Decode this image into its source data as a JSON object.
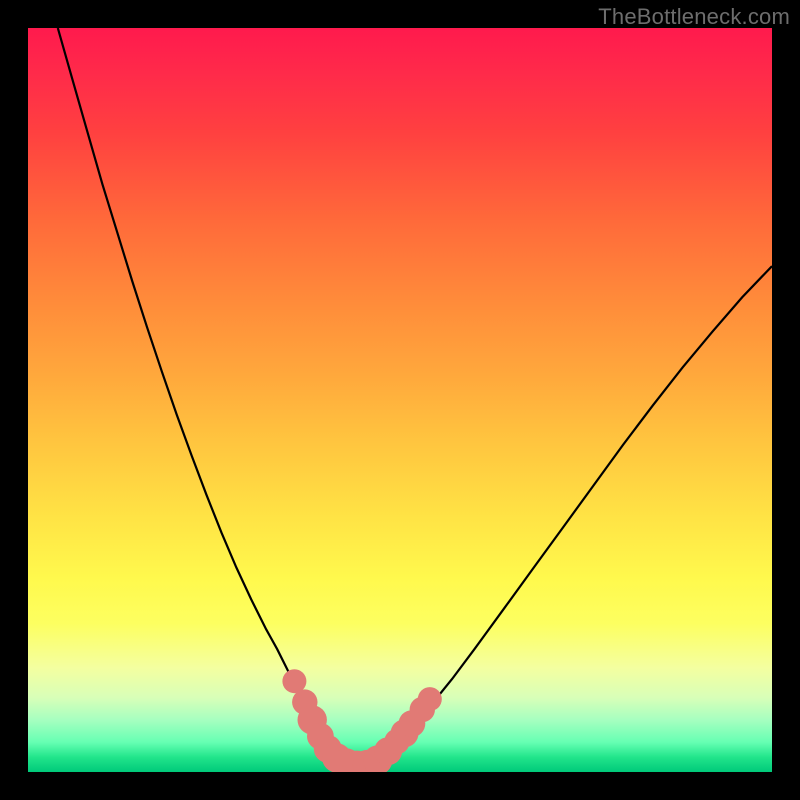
{
  "watermark": "TheBottleneck.com",
  "colors": {
    "frame": "#000000",
    "curve": "#000000",
    "marker_fill": "#e17a75",
    "marker_stroke": "#d96259"
  },
  "chart_data": {
    "type": "line",
    "title": "",
    "xlabel": "",
    "ylabel": "",
    "xlim": [
      0,
      100
    ],
    "ylim": [
      0,
      100
    ],
    "series": [
      {
        "name": "left-branch",
        "x": [
          4,
          6,
          8,
          10,
          12,
          14,
          16,
          18,
          20,
          22,
          24,
          26,
          28,
          30,
          32,
          33.5,
          35,
          36.5,
          38,
          39,
          40,
          41
        ],
        "y": [
          100,
          93,
          86,
          79,
          72.5,
          66,
          59.8,
          53.8,
          48,
          42.5,
          37.2,
          32.2,
          27.5,
          23.2,
          19.2,
          16.5,
          13.5,
          10.5,
          7.5,
          5.5,
          3.8,
          2.5
        ]
      },
      {
        "name": "floor",
        "x": [
          41,
          42,
          43,
          44,
          45,
          46,
          47,
          48
        ],
        "y": [
          2.5,
          1.6,
          1.0,
          0.8,
          0.8,
          1.0,
          1.6,
          2.5
        ]
      },
      {
        "name": "right-branch",
        "x": [
          48,
          50,
          52,
          54,
          57,
          60,
          64,
          68,
          72,
          76,
          80,
          84,
          88,
          92,
          96,
          100
        ],
        "y": [
          2.5,
          4.3,
          6.4,
          8.8,
          12.5,
          16.5,
          22.0,
          27.5,
          33.0,
          38.5,
          44.0,
          49.3,
          54.4,
          59.2,
          63.8,
          68.0
        ]
      }
    ],
    "markers": {
      "name": "highlight-points",
      "points": [
        {
          "x": 35.8,
          "y": 12.2,
          "r": 1.2
        },
        {
          "x": 37.2,
          "y": 9.4,
          "r": 1.3
        },
        {
          "x": 38.2,
          "y": 7.0,
          "r": 1.6
        },
        {
          "x": 39.3,
          "y": 4.8,
          "r": 1.4
        },
        {
          "x": 40.3,
          "y": 3.1,
          "r": 1.5
        },
        {
          "x": 41.5,
          "y": 1.9,
          "r": 1.6
        },
        {
          "x": 42.8,
          "y": 1.2,
          "r": 1.6
        },
        {
          "x": 44.2,
          "y": 0.9,
          "r": 1.6
        },
        {
          "x": 45.6,
          "y": 1.0,
          "r": 1.6
        },
        {
          "x": 47.0,
          "y": 1.6,
          "r": 1.6
        },
        {
          "x": 48.4,
          "y": 2.8,
          "r": 1.5
        },
        {
          "x": 49.6,
          "y": 4.1,
          "r": 1.3
        },
        {
          "x": 50.6,
          "y": 5.2,
          "r": 1.5
        },
        {
          "x": 51.6,
          "y": 6.5,
          "r": 1.4
        },
        {
          "x": 53.0,
          "y": 8.4,
          "r": 1.3
        },
        {
          "x": 54.0,
          "y": 9.8,
          "r": 1.2
        }
      ]
    }
  }
}
